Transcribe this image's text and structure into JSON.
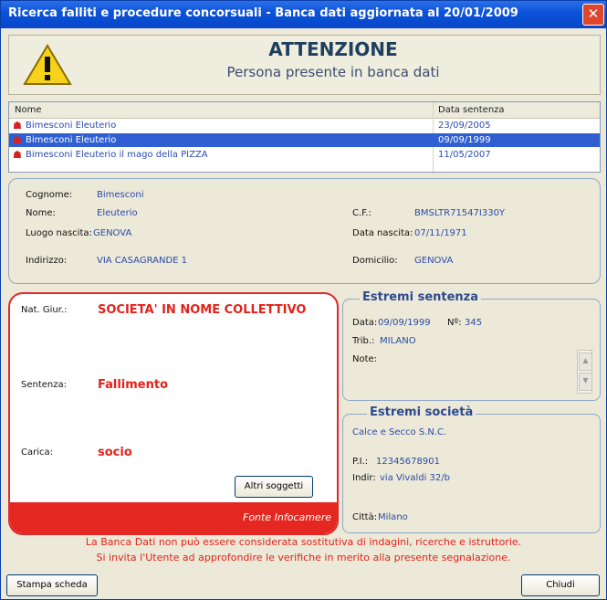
{
  "window": {
    "title": "Ricerca falliti e procedure concorsuali - Banca dati aggiornata al 20/01/2009",
    "close_label": "✕"
  },
  "warning": {
    "heading": "ATTENZIONE",
    "subheading": "Persona presente in banca dati"
  },
  "results": {
    "columns": [
      "Nome",
      "Data sentenza"
    ],
    "rows": [
      {
        "name": "Bimesconi Eleuterio",
        "date": "23/09/2005",
        "selected": false
      },
      {
        "name": "Bimesconi Eleuterio",
        "date": "09/09/1999",
        "selected": true
      },
      {
        "name": "Bimesconi Eleuterio il mago della PIZZA",
        "date": "11/05/2007",
        "selected": false
      }
    ]
  },
  "person": {
    "cognome_label": "Cognome:",
    "cognome": "Bimesconi",
    "nome_label": "Nome:",
    "nome": "Eleuterio",
    "cf_label": "C.F.:",
    "cf": "BMSLTR71547I330Y",
    "luogo_label": "Luogo nascita:",
    "luogo": "GENOVA",
    "data_nascita_label": "Data nascita:",
    "data_nascita": "07/11/1971",
    "indirizzo_label": "Indirizzo:",
    "indirizzo": "VIA CASAGRANDE 1",
    "domicilio_label": "Domicilio:",
    "domicilio": "GENOVA"
  },
  "company_role": {
    "nat_label": "Nat. Giur.:",
    "nat": "SOCIETA' IN NOME COLLETTIVO",
    "sentenza_label": "Sentenza:",
    "sentenza": "Fallimento",
    "carica_label": "Carica:",
    "carica": "socio",
    "altri_button": "Altri soggetti",
    "fonte": "Fonte Infocamere"
  },
  "estremi_sentenza": {
    "title": "Estremi sentenza",
    "data_label": "Data:",
    "data": "09/09/1999",
    "nr_label": "Nº:",
    "nr": "345",
    "trib_label": "Trib.:",
    "trib": "MILANO",
    "note_label": "Note:"
  },
  "estremi_societa": {
    "title": "Estremi società",
    "ragione": "Calce e Secco S.N.C.",
    "pi_label": "P.I.:",
    "pi": "12345678901",
    "indir_label": "Indir:",
    "indir": "via Vivaldi 32/b",
    "citta_label": "Città:",
    "citta": "Milano"
  },
  "notice": {
    "line1": "La Banca Dati non può essere considerata sostitutiva di indagini, ricerche e istruttorie.",
    "line2": "Si invita l'Utente ad approfondire le verifiche in merito alla presente segnalazione."
  },
  "buttons": {
    "print": "Stampa scheda",
    "close": "Chiudi"
  },
  "colors": {
    "accent_red": "#e2221a",
    "titlebar_blue": "#0b53d9",
    "value_blue": "#2c4aa7"
  }
}
